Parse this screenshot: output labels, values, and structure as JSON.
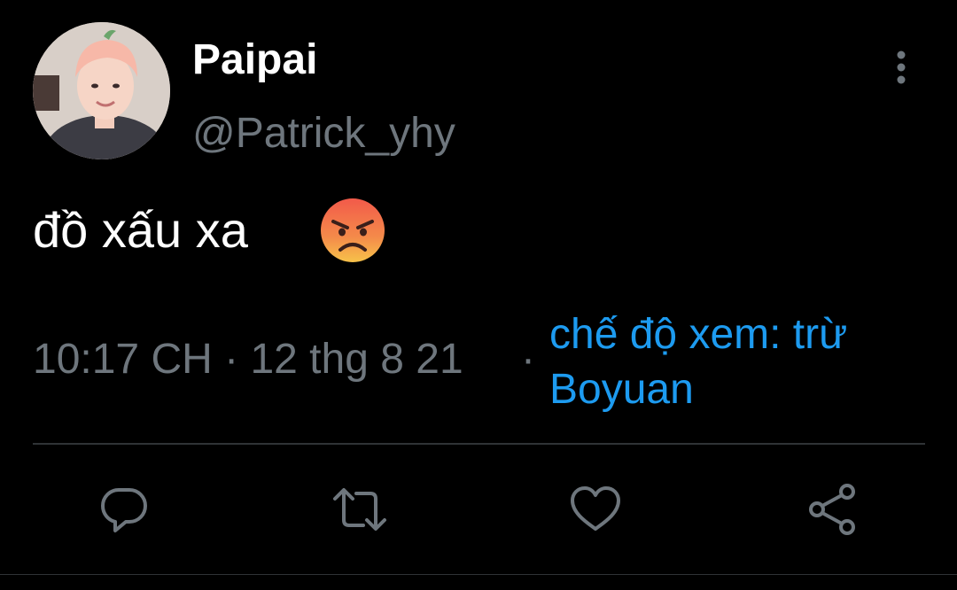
{
  "tweet": {
    "display_name": "Paipai",
    "handle": "@Patrick_yhy",
    "text": "đồ xấu xa",
    "emoji": "angry-face",
    "time": "10:17 CH · 12 thg 8 21",
    "separator": "·",
    "audience": "chế độ xem: trừ Boyuan"
  },
  "actions": [
    {
      "icon": "reply-icon"
    },
    {
      "icon": "retweet-icon"
    },
    {
      "icon": "like-icon"
    },
    {
      "icon": "share-icon"
    }
  ],
  "colors": {
    "background": "#000000",
    "text": "#ffffff",
    "secondary": "#6e767d",
    "link": "#1d9bf0",
    "divider": "#2f3336"
  }
}
